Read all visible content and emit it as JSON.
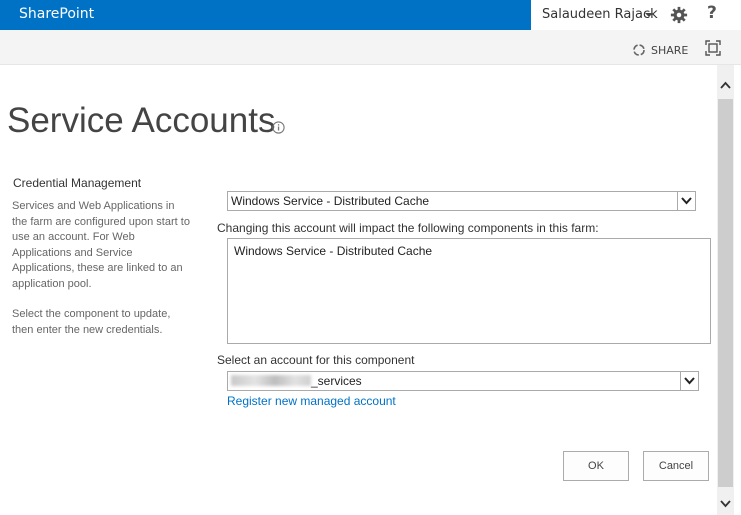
{
  "suite_bar": {
    "brand": "SharePoint",
    "user_name": "Salaudeen Rajack",
    "help_glyph": "?",
    "brand_color": "#0072c6"
  },
  "ribbon": {
    "share_label": "SHARE"
  },
  "page": {
    "title": "Service Accounts"
  },
  "credential_section": {
    "title": "Credential Management",
    "description_1": "Services and Web Applications in the farm are configured upon start to use an account. For Web Applications and Service Applications, these are linked to an application pool.",
    "description_2": "Select the component to update, then enter the new credentials."
  },
  "form": {
    "component_select_value": "Windows Service - Distributed Cache",
    "impact_label": "Changing this account will impact the following components in this farm:",
    "impacted_components": [
      "Windows Service - Distributed Cache"
    ],
    "account_label": "Select an account for this component",
    "account_value_suffix": "_services",
    "register_link": "Register new managed account"
  },
  "actions": {
    "ok_label": "OK",
    "cancel_label": "Cancel"
  },
  "icons": {
    "gear": "gear-icon",
    "share": "share-icon",
    "focus": "focus-on-content-icon",
    "info": "info-icon",
    "dropdown_arrow": "chevron-down-icon"
  }
}
